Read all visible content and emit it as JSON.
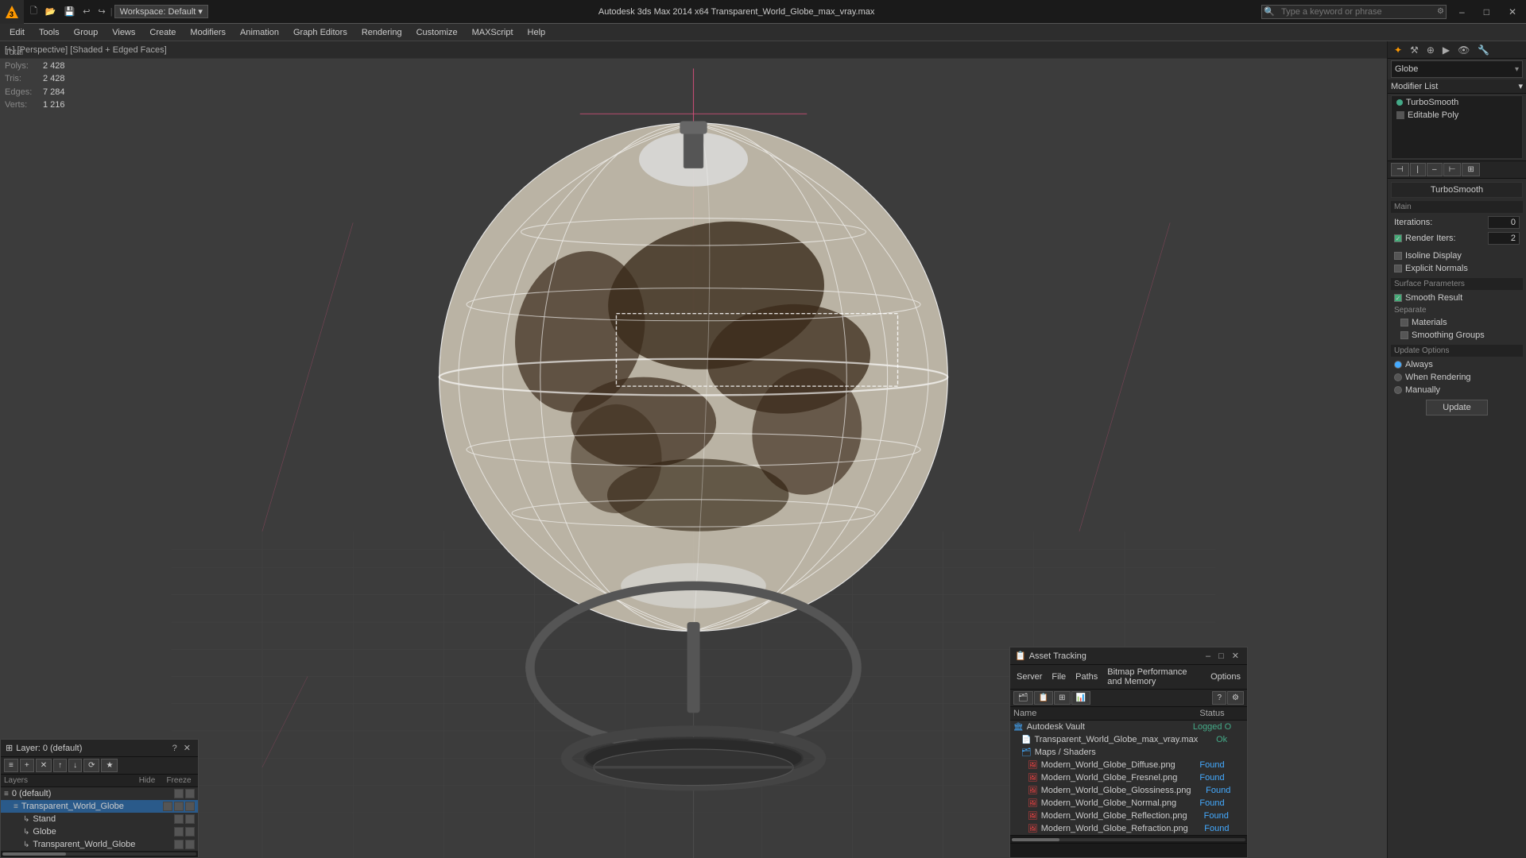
{
  "titlebar": {
    "app_title": "Autodesk 3ds Max 2014 x64",
    "file_name": "Transparent_World_Globe_max_vray.max",
    "full_title": "Autodesk 3ds Max 2014 x64    Transparent_World_Globe_max_vray.max",
    "minimize": "–",
    "maximize": "□",
    "close": "✕"
  },
  "search": {
    "placeholder": "Type a keyword or phrase"
  },
  "menubar": {
    "items": [
      "Edit",
      "Tools",
      "Group",
      "Views",
      "Create",
      "Modifiers",
      "Animation",
      "Graph Editors",
      "Rendering",
      "Customize",
      "MAXScript",
      "Help"
    ]
  },
  "viewport": {
    "label": "[+] [Perspective] [Shaded + Edged Faces]"
  },
  "stats": {
    "total_label": "Total",
    "polys_label": "Polys:",
    "polys_val": "2 428",
    "tris_label": "Tris:",
    "tris_val": "2 428",
    "edges_label": "Edges:",
    "edges_val": "7 284",
    "verts_label": "Verts:",
    "verts_val": "1 216"
  },
  "right_panel": {
    "object_name": "Globe",
    "modifier_list_label": "Modifier List",
    "modifiers": [
      {
        "name": "TurboSmooth",
        "active": true
      },
      {
        "name": "Editable Poly",
        "active": false
      }
    ],
    "turbosmooth": {
      "title": "TurboSmooth",
      "main_label": "Main",
      "iterations_label": "Iterations:",
      "iterations_val": "0",
      "render_iters_label": "Render Iters:",
      "render_iters_val": "2",
      "isoline_label": "Isoline Display",
      "explicit_label": "Explicit Normals",
      "surface_label": "Surface Parameters",
      "smooth_label": "Smooth Result",
      "separate_label": "Separate",
      "materials_label": "Materials",
      "smoothing_label": "Smoothing Groups",
      "update_label": "Update Options",
      "always_label": "Always",
      "when_rendering_label": "When Rendering",
      "manually_label": "Manually",
      "update_btn": "Update"
    }
  },
  "layers_panel": {
    "title": "Layer: 0 (default)",
    "question": "?",
    "close": "✕",
    "toolbar_icons": [
      "≡",
      "+",
      "✕",
      "↑",
      "↓",
      "⟳",
      "★"
    ],
    "header_name": "Layers",
    "header_hide": "Hide",
    "header_freeze": "Freeze",
    "items": [
      {
        "name": "0 (default)",
        "level": 0,
        "icon": "≡",
        "selected": false
      },
      {
        "name": "Transparent_World_Globe",
        "level": 1,
        "icon": "≡",
        "selected": true
      },
      {
        "name": "Stand",
        "level": 2,
        "icon": "↳",
        "selected": false
      },
      {
        "name": "Globe",
        "level": 2,
        "icon": "↳",
        "selected": false
      },
      {
        "name": "Transparent_World_Globe",
        "level": 2,
        "icon": "↳",
        "selected": false
      }
    ]
  },
  "asset_panel": {
    "title": "Asset Tracking",
    "menu_items": [
      "Server",
      "File",
      "Paths",
      "Bitmap Performance and Memory",
      "Options"
    ],
    "toolbar_icons": [
      "🗂",
      "📋",
      "🔄",
      "💾"
    ],
    "help_icon": "?",
    "settings_icon": "⚙",
    "header_name": "Name",
    "header_status": "Status",
    "items": [
      {
        "name": "Autodesk Vault",
        "level": 0,
        "icon": "🏛",
        "status": "Logged O",
        "status_class": "status-ok"
      },
      {
        "name": "Transparent_World_Globe_max_vray.max",
        "level": 1,
        "icon": "📄",
        "status": "Ok",
        "status_class": "status-ok"
      },
      {
        "name": "Maps / Shaders",
        "level": 1,
        "icon": "🗂",
        "status": "",
        "status_class": ""
      },
      {
        "name": "Modern_World_Globe_Diffuse.png",
        "level": 2,
        "icon": "🖼",
        "status": "Found",
        "status_class": "status-found"
      },
      {
        "name": "Modern_World_Globe_Fresnel.png",
        "level": 2,
        "icon": "🖼",
        "status": "Found",
        "status_class": "status-found"
      },
      {
        "name": "Modern_World_Globe_Glossiness.png",
        "level": 2,
        "icon": "🖼",
        "status": "Found",
        "status_class": "status-found"
      },
      {
        "name": "Modern_World_Globe_Normal.png",
        "level": 2,
        "icon": "🖼",
        "status": "Found",
        "status_class": "status-found"
      },
      {
        "name": "Modern_World_Globe_Reflection.png",
        "level": 2,
        "icon": "🖼",
        "status": "Found",
        "status_class": "status-found"
      },
      {
        "name": "Modern_World_Globe_Refraction.png",
        "level": 2,
        "icon": "🖼",
        "status": "Found",
        "status_class": "status-found"
      }
    ]
  }
}
